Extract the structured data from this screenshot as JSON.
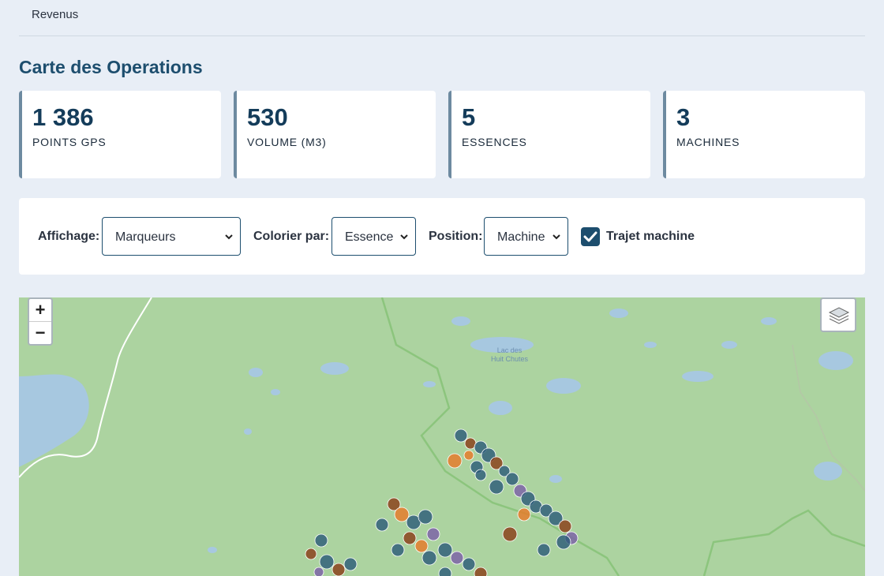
{
  "nav": {
    "revenus": "Revenus"
  },
  "page": {
    "title": "Carte des Operations"
  },
  "stats": [
    {
      "value": "1 386",
      "label": "POINTS GPS"
    },
    {
      "value": "530",
      "label": "VOLUME (M3)"
    },
    {
      "value": "5",
      "label": "ESSENCES"
    },
    {
      "value": "3",
      "label": "MACHINES"
    }
  ],
  "controls": {
    "affichage_label": "Affichage:",
    "affichage_value": "Marqueurs",
    "colorier_label": "Colorier par:",
    "colorier_value": "Essence",
    "position_label": "Position:",
    "position_value": "Machine",
    "trajet_label": "Trajet machine",
    "trajet_checked": true
  },
  "map": {
    "zoom_in": "+",
    "zoom_out": "−",
    "lake_label_line1": "Lac des",
    "lake_label_line2": "Huit Chutes",
    "marker_colors": [
      "#2b5a78",
      "#8a3b14",
      "#e87826",
      "#7b5ea7"
    ]
  }
}
